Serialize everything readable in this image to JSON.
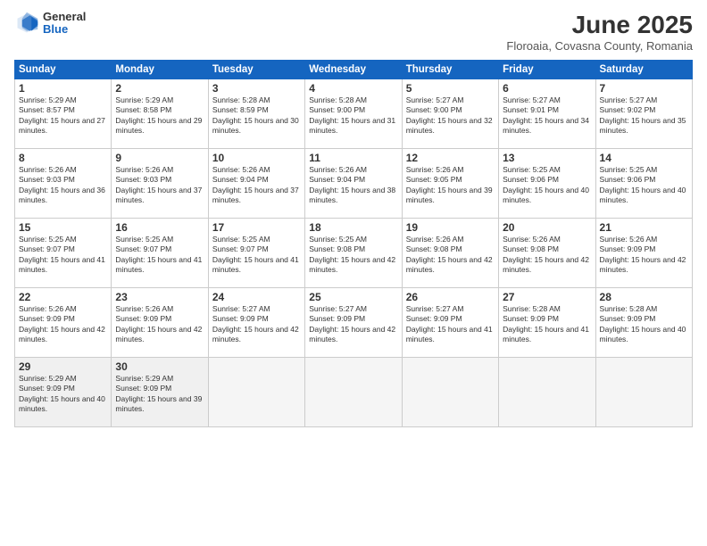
{
  "logo": {
    "general": "General",
    "blue": "Blue"
  },
  "title": "June 2025",
  "subtitle": "Floroaia, Covasna County, Romania",
  "headers": [
    "Sunday",
    "Monday",
    "Tuesday",
    "Wednesday",
    "Thursday",
    "Friday",
    "Saturday"
  ],
  "weeks": [
    [
      {
        "day": "1",
        "rise": "5:29 AM",
        "set": "8:57 PM",
        "daylight": "15 hours and 27 minutes."
      },
      {
        "day": "2",
        "rise": "5:29 AM",
        "set": "8:58 PM",
        "daylight": "15 hours and 29 minutes."
      },
      {
        "day": "3",
        "rise": "5:28 AM",
        "set": "8:59 PM",
        "daylight": "15 hours and 30 minutes."
      },
      {
        "day": "4",
        "rise": "5:28 AM",
        "set": "9:00 PM",
        "daylight": "15 hours and 31 minutes."
      },
      {
        "day": "5",
        "rise": "5:27 AM",
        "set": "9:00 PM",
        "daylight": "15 hours and 32 minutes."
      },
      {
        "day": "6",
        "rise": "5:27 AM",
        "set": "9:01 PM",
        "daylight": "15 hours and 34 minutes."
      },
      {
        "day": "7",
        "rise": "5:27 AM",
        "set": "9:02 PM",
        "daylight": "15 hours and 35 minutes."
      }
    ],
    [
      {
        "day": "8",
        "rise": "5:26 AM",
        "set": "9:03 PM",
        "daylight": "15 hours and 36 minutes."
      },
      {
        "day": "9",
        "rise": "5:26 AM",
        "set": "9:03 PM",
        "daylight": "15 hours and 37 minutes."
      },
      {
        "day": "10",
        "rise": "5:26 AM",
        "set": "9:04 PM",
        "daylight": "15 hours and 37 minutes."
      },
      {
        "day": "11",
        "rise": "5:26 AM",
        "set": "9:04 PM",
        "daylight": "15 hours and 38 minutes."
      },
      {
        "day": "12",
        "rise": "5:26 AM",
        "set": "9:05 PM",
        "daylight": "15 hours and 39 minutes."
      },
      {
        "day": "13",
        "rise": "5:25 AM",
        "set": "9:06 PM",
        "daylight": "15 hours and 40 minutes."
      },
      {
        "day": "14",
        "rise": "5:25 AM",
        "set": "9:06 PM",
        "daylight": "15 hours and 40 minutes."
      }
    ],
    [
      {
        "day": "15",
        "rise": "5:25 AM",
        "set": "9:07 PM",
        "daylight": "15 hours and 41 minutes."
      },
      {
        "day": "16",
        "rise": "5:25 AM",
        "set": "9:07 PM",
        "daylight": "15 hours and 41 minutes."
      },
      {
        "day": "17",
        "rise": "5:25 AM",
        "set": "9:07 PM",
        "daylight": "15 hours and 41 minutes."
      },
      {
        "day": "18",
        "rise": "5:25 AM",
        "set": "9:08 PM",
        "daylight": "15 hours and 42 minutes."
      },
      {
        "day": "19",
        "rise": "5:26 AM",
        "set": "9:08 PM",
        "daylight": "15 hours and 42 minutes."
      },
      {
        "day": "20",
        "rise": "5:26 AM",
        "set": "9:08 PM",
        "daylight": "15 hours and 42 minutes."
      },
      {
        "day": "21",
        "rise": "5:26 AM",
        "set": "9:09 PM",
        "daylight": "15 hours and 42 minutes."
      }
    ],
    [
      {
        "day": "22",
        "rise": "5:26 AM",
        "set": "9:09 PM",
        "daylight": "15 hours and 42 minutes."
      },
      {
        "day": "23",
        "rise": "5:26 AM",
        "set": "9:09 PM",
        "daylight": "15 hours and 42 minutes."
      },
      {
        "day": "24",
        "rise": "5:27 AM",
        "set": "9:09 PM",
        "daylight": "15 hours and 42 minutes."
      },
      {
        "day": "25",
        "rise": "5:27 AM",
        "set": "9:09 PM",
        "daylight": "15 hours and 42 minutes."
      },
      {
        "day": "26",
        "rise": "5:27 AM",
        "set": "9:09 PM",
        "daylight": "15 hours and 41 minutes."
      },
      {
        "day": "27",
        "rise": "5:28 AM",
        "set": "9:09 PM",
        "daylight": "15 hours and 41 minutes."
      },
      {
        "day": "28",
        "rise": "5:28 AM",
        "set": "9:09 PM",
        "daylight": "15 hours and 40 minutes."
      }
    ],
    [
      {
        "day": "29",
        "rise": "5:29 AM",
        "set": "9:09 PM",
        "daylight": "15 hours and 40 minutes."
      },
      {
        "day": "30",
        "rise": "5:29 AM",
        "set": "9:09 PM",
        "daylight": "15 hours and 39 minutes."
      },
      null,
      null,
      null,
      null,
      null
    ]
  ]
}
